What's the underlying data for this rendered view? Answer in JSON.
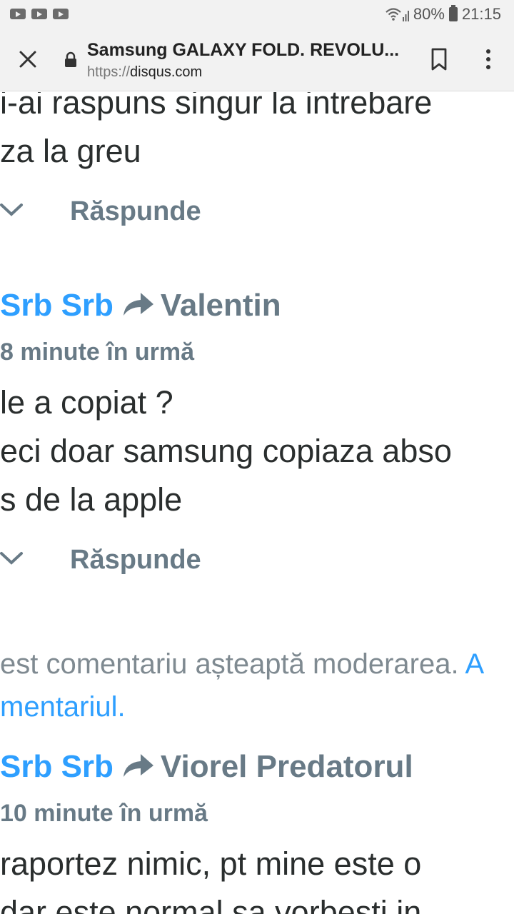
{
  "status_bar": {
    "notification_icons": [
      "youtube-icon",
      "youtube-icon",
      "youtube-icon"
    ],
    "battery": "80%",
    "time": "21:15"
  },
  "browser": {
    "title": "Samsung GALAXY FOLD. REVOLU...",
    "url_protocol": "https://",
    "url_host": "disqus.com"
  },
  "comments": [
    {
      "body_lines": [
        "i-ai raspuns singur la intrebare",
        "za la greu"
      ],
      "reply_label": "Răspunde"
    },
    {
      "author": "Srb Srb",
      "reply_to": "Valentin",
      "time": "8 minute în urmă",
      "body_lines": [
        "le a copiat ?",
        "eci doar samsung copiaza abso",
        "s de la apple"
      ],
      "reply_label": "Răspunde"
    },
    {
      "moderation_text": "est comentariu așteaptă moderarea.",
      "moderation_link_start": "A",
      "moderation_link_end": "mentariul."
    },
    {
      "author": "Srb Srb",
      "reply_to": "Viorel Predatorul",
      "time": "10 minute în urmă",
      "body_lines": [
        "raportez nimic, pt mine este o",
        "dar este normal sa vorbesti in"
      ]
    }
  ],
  "colors": {
    "author": "#2e9fff",
    "muted": "#687a86",
    "text": "#2a2e2e",
    "link": "#2e9fff"
  }
}
